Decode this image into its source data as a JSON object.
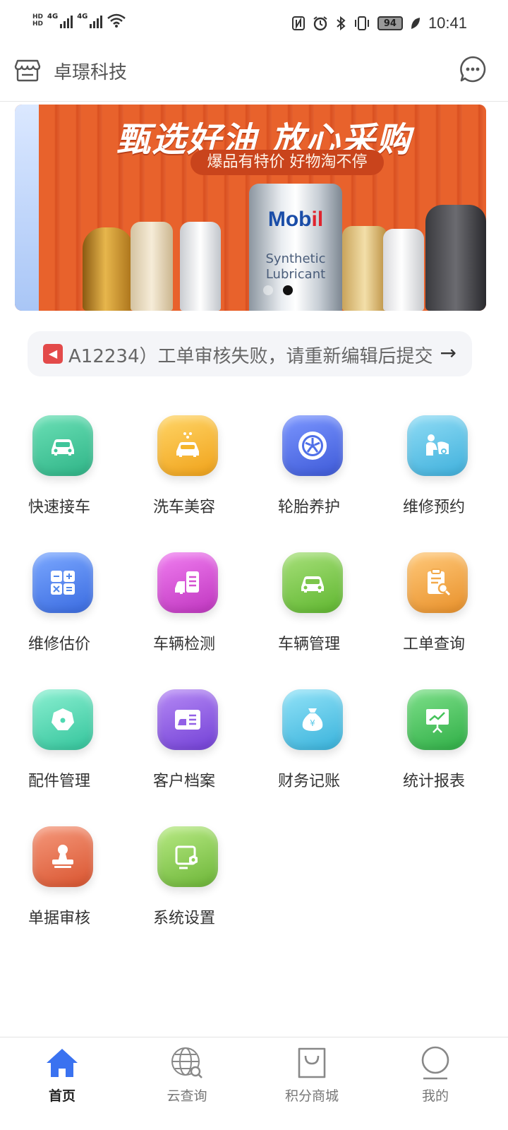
{
  "status_bar": {
    "left_icons": [
      "hd-icon",
      "signal-4g-icon",
      "signal-4g-icon",
      "wifi-icon"
    ],
    "network_label_1": "4G",
    "network_label_2": "4G",
    "hd_top": "HD",
    "hd_bottom": "HD",
    "right_icons": [
      "nfc-icon",
      "alarm-icon",
      "bluetooth-icon",
      "vibrate-icon",
      "battery-icon",
      "leaf-icon"
    ],
    "battery": "94",
    "time": "10:41"
  },
  "header": {
    "title": "卓璟科技",
    "left_icon": "store-icon",
    "right_icon": "chat-bubble-icon"
  },
  "banner": {
    "title": "甄选好油 放心采购",
    "subtitle": "爆品有特价 好物淘不停",
    "brand_a": "Mob",
    "brand_b": "il",
    "product_line1": "Synthetic",
    "product_line2": "Lubricant",
    "slide_count": 2,
    "active_slide": 2
  },
  "notice": {
    "icon": "speaker-icon",
    "text": "A12234）工单审核失败，请重新编辑后提交",
    "arrow": "→"
  },
  "grid": [
    {
      "label": "快速接车",
      "icon": "car-front-icon",
      "color": "#3fc59a"
    },
    {
      "label": "洗车美容",
      "icon": "car-wash-icon",
      "color": "#f5b52c"
    },
    {
      "label": "轮胎养护",
      "icon": "tire-icon",
      "color": "#4f6fe8"
    },
    {
      "label": "维修预约",
      "icon": "mechanic-icon",
      "color": "#5ec3e6"
    },
    {
      "label": "维修估价",
      "icon": "calculator-icon",
      "color": "#4f86ea"
    },
    {
      "label": "车辆检测",
      "icon": "vehicle-check-icon",
      "color": "#d550d0"
    },
    {
      "label": "车辆管理",
      "icon": "car-front-icon",
      "color": "#7cc64b"
    },
    {
      "label": "工单查询",
      "icon": "clipboard-search-icon",
      "color": "#f2a94a"
    },
    {
      "label": "配件管理",
      "icon": "nut-icon",
      "color": "#4fd9b2"
    },
    {
      "label": "客户档案",
      "icon": "customer-card-icon",
      "color": "#9260e6"
    },
    {
      "label": "财务记账",
      "icon": "money-bag-icon",
      "color": "#5cc9e8"
    },
    {
      "label": "统计报表",
      "icon": "presentation-chart-icon",
      "color": "#45c35a"
    },
    {
      "label": "单据审核",
      "icon": "stamp-icon",
      "color": "#e8704f"
    },
    {
      "label": "系统设置",
      "icon": "settings-gear-icon",
      "color": "#8fcf55"
    }
  ],
  "bottom_nav": [
    {
      "label": "首页",
      "icon": "home-icon",
      "active": true
    },
    {
      "label": "云查询",
      "icon": "globe-search-icon",
      "active": false
    },
    {
      "label": "积分商城",
      "icon": "shopping-bag-icon",
      "active": false
    },
    {
      "label": "我的",
      "icon": "user-icon",
      "active": false
    }
  ],
  "colors": {
    "accent": "#3a72f0",
    "banner_bg": "#e8622c"
  }
}
